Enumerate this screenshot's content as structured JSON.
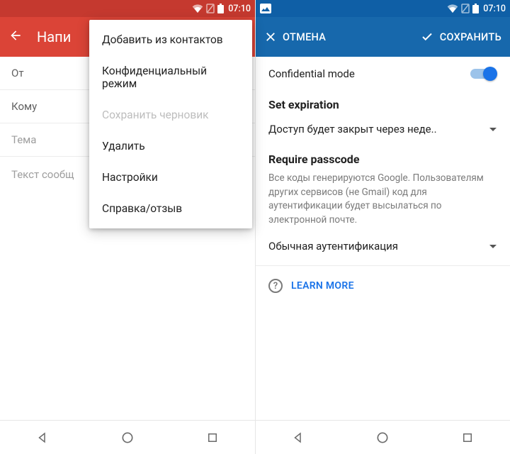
{
  "left": {
    "status_time": "07:10",
    "appbar_title": "Напи",
    "fields": {
      "from_label": "От",
      "to_label": "Кому",
      "subject_placeholder": "Тема",
      "body_placeholder": "Текст сообщ"
    },
    "menu": [
      {
        "label": "Добавить из контактов",
        "enabled": true
      },
      {
        "label": "Конфиденциальный режим",
        "enabled": true
      },
      {
        "label": "Сохранить черновик",
        "enabled": false
      },
      {
        "label": "Удалить",
        "enabled": true
      },
      {
        "label": "Настройки",
        "enabled": true
      },
      {
        "label": "Справка/отзыв",
        "enabled": true
      }
    ]
  },
  "right": {
    "status_time": "07:10",
    "actions": {
      "cancel": "ОТМЕНА",
      "save": "СОХРАНИТЬ"
    },
    "confidential_label": "Confidential mode",
    "confidential_on": true,
    "expiration_title": "Set expiration",
    "expiration_value": "Доступ будет закрыт через неде..",
    "passcode_title": "Require passcode",
    "passcode_hint": "Все коды генерируются Google. Пользователям других сервисов (не Gmail) код для аутентификации будет высылаться по электронной почте.",
    "passcode_value": "Обычная аутентификация",
    "learn_more": "LEARN MORE"
  }
}
